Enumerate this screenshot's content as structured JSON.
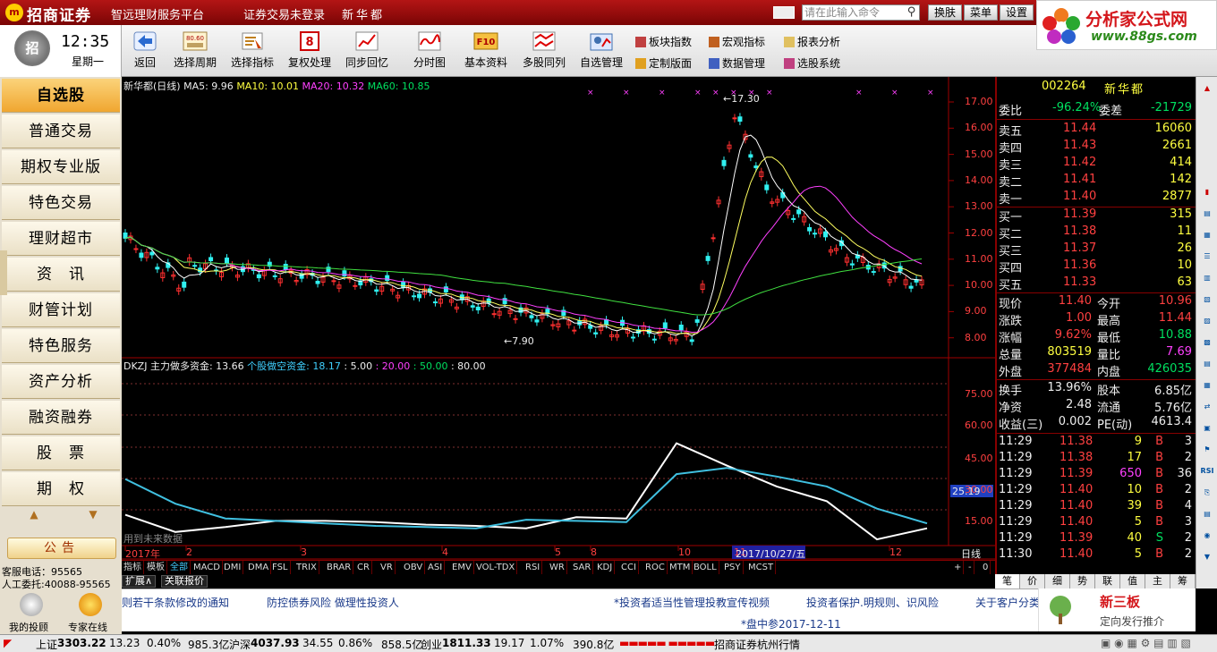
{
  "titlebar": {
    "logo_mark": "m",
    "logo": "招商证券",
    "platform": "智远理财服务平台",
    "login_status": "证券交易未登录",
    "stock_name": "新华都",
    "command_placeholder": "请在此输入命令",
    "buttons": [
      "换肤",
      "菜单",
      "设置"
    ]
  },
  "brand": {
    "name": "分析家公式网",
    "url": "www.88gs.com"
  },
  "clock": {
    "time": "12:35",
    "weekday": "星期一",
    "icon_text": "招"
  },
  "toolbar": {
    "buttons": [
      {
        "label": "返回",
        "icon": "back-arrow-icon"
      },
      {
        "label": "选择周期",
        "icon": "period-icon",
        "icon_text": "80.60"
      },
      {
        "label": "选择指标",
        "icon": "indicator-icon"
      },
      {
        "label": "复权处理",
        "icon": "restore-rights-icon",
        "icon_text": "8"
      },
      {
        "label": "同步回忆",
        "icon": "sync-recall-icon"
      },
      {
        "label": "分时图",
        "icon": "intraday-chart-icon"
      },
      {
        "label": "基本资料",
        "icon": "f10-icon",
        "icon_text": "F10"
      },
      {
        "label": "多股同列",
        "icon": "multi-stock-icon"
      },
      {
        "label": "自选管理",
        "icon": "watchlist-manage-icon"
      }
    ],
    "links": [
      {
        "label": "板块指数",
        "icon": "sector-index-icon"
      },
      {
        "label": "宏观指标",
        "icon": "macro-indicator-icon"
      },
      {
        "label": "报表分析",
        "icon": "report-analysis-icon"
      },
      {
        "label": "定制版面",
        "icon": "custom-layout-icon"
      },
      {
        "label": "数据管理",
        "icon": "data-manage-icon"
      },
      {
        "label": "选股系统",
        "icon": "stock-screener-icon"
      }
    ]
  },
  "sidebar": {
    "items": [
      "自选股",
      "普通交易",
      "期权专业版",
      "特色交易",
      "理财超市",
      "资　讯",
      "财管计划",
      "特色服务",
      "资产分析",
      "融资融券",
      "股　票",
      "期　权"
    ],
    "active_index": 0,
    "scroll_up": "▲",
    "scroll_down": "▼",
    "notice": "公告",
    "hotline": "客服电话：95565",
    "entrust": "人工委托:40088-95565",
    "my_advisor": "我的投顾",
    "expert_online": "专家在线"
  },
  "chart": {
    "header": {
      "name": "新华都(日线)",
      "ma5": "MA5: 9.96",
      "ma10": "MA10: 10.01",
      "ma20": "MA20: 10.32",
      "ma60": "MA60: 10.85"
    },
    "price_max_label": "17.30",
    "price_min_label": "7.90",
    "price_axis": [
      "17.00",
      "16.00",
      "15.00",
      "14.00",
      "13.00",
      "12.00",
      "11.00",
      "10.00",
      "9.00",
      "8.00"
    ],
    "indicator": {
      "name": "DKZJ",
      "main_label": "主力做多资金: 13.66",
      "retail_label": "个股做空资金: 18.17",
      "level1": ": 5.00",
      "level2": ": 20.00",
      "level3": ": 50.00",
      "level4": ": 80.00",
      "axis": [
        "75.00",
        "60.00",
        "45.00",
        "30.00",
        "15.00"
      ],
      "current": "25.19",
      "note": "用到未来数据"
    },
    "date_axis": [
      "2017年",
      "2",
      "3",
      "4",
      "5",
      "8",
      "10",
      "11",
      "12"
    ],
    "cursor_date": "2017/10/27/五",
    "period": "日线",
    "colors": {
      "up": "#ff3030",
      "down": "#30f0f0",
      "ma5": "#ffffff",
      "ma10": "#ffff60",
      "ma20": "#ff40ff",
      "ma60": "#40e040",
      "retail": "#40c0e0"
    },
    "chart_data": {
      "type": "line",
      "series": [
        {
          "name": "主力做多资金",
          "values": [
            25,
            11,
            15,
            20,
            20,
            19,
            17,
            16,
            14,
            23,
            22,
            83,
            65,
            48,
            36,
            5,
            14
          ]
        },
        {
          "name": "个股做空资金",
          "values": [
            54,
            34,
            22,
            20,
            18,
            16,
            15,
            14,
            21,
            20,
            19,
            58,
            63,
            56,
            48,
            30,
            18
          ]
        }
      ]
    }
  },
  "indicator_tabs": [
    "指标",
    "模板",
    "全部",
    "MACD",
    "DMI",
    "DMA",
    "FSL",
    "TRIX",
    "BRAR",
    "CR",
    "VR",
    "OBV",
    "ASI",
    "EMV",
    "VOL-TDX",
    "RSI",
    "WR",
    "SAR",
    "KDJ",
    "CCI",
    "ROC",
    "MTM",
    "BOLL",
    "PSY",
    "MCST"
  ],
  "indicator_tab_controls": [
    "+",
    "-",
    "0"
  ],
  "ext_tabs": [
    "扩展∧",
    "关联报价"
  ],
  "quote": {
    "code": "002264",
    "name": "新华都",
    "webi_label": "委比",
    "webi": "-96.24%",
    "weicha_label": "委差",
    "weicha": "-21729",
    "asks": [
      {
        "label": "卖五",
        "price": "11.44",
        "vol": "16060"
      },
      {
        "label": "卖四",
        "price": "11.43",
        "vol": "2661"
      },
      {
        "label": "卖三",
        "price": "11.42",
        "vol": "414"
      },
      {
        "label": "卖二",
        "price": "11.41",
        "vol": "142"
      },
      {
        "label": "卖一",
        "price": "11.40",
        "vol": "2877"
      }
    ],
    "bids": [
      {
        "label": "买一",
        "price": "11.39",
        "vol": "315"
      },
      {
        "label": "买二",
        "price": "11.38",
        "vol": "11"
      },
      {
        "label": "买三",
        "price": "11.37",
        "vol": "26"
      },
      {
        "label": "买四",
        "price": "11.36",
        "vol": "10"
      },
      {
        "label": "买五",
        "price": "11.33",
        "vol": "63"
      }
    ],
    "stats": [
      {
        "l1": "现价",
        "v1": "11.40",
        "l2": "今开",
        "v2": "10.96"
      },
      {
        "l1": "涨跌",
        "v1": "1.00",
        "l2": "最高",
        "v2": "11.44"
      },
      {
        "l1": "涨幅",
        "v1": "9.62%",
        "l2": "最低",
        "v2": "10.88"
      },
      {
        "l1": "总量",
        "v1": "803519",
        "l2": "量比",
        "v2": "7.69"
      },
      {
        "l1": "外盘",
        "v1": "377484",
        "l2": "内盘",
        "v2": "426035"
      }
    ],
    "fund": [
      {
        "l1": "换手",
        "v1": "13.96%",
        "l2": "股本",
        "v2": "6.85亿"
      },
      {
        "l1": "净资",
        "v1": "2.48",
        "l2": "流通",
        "v2": "5.76亿"
      },
      {
        "l1": "收益(三)",
        "v1": "0.002",
        "l2": "PE(动)",
        "v2": "4613.4"
      }
    ],
    "ticks": [
      {
        "time": "11:29",
        "price": "11.38",
        "vol": "9",
        "bs": "B",
        "n": "3"
      },
      {
        "time": "11:29",
        "price": "11.38",
        "vol": "17",
        "bs": "B",
        "n": "2"
      },
      {
        "time": "11:29",
        "price": "11.39",
        "vol": "650",
        "bs": "B",
        "n": "36"
      },
      {
        "time": "11:29",
        "price": "11.40",
        "vol": "10",
        "bs": "B",
        "n": "2"
      },
      {
        "time": "11:29",
        "price": "11.40",
        "vol": "39",
        "bs": "B",
        "n": "4"
      },
      {
        "time": "11:29",
        "price": "11.40",
        "vol": "5",
        "bs": "B",
        "n": "3"
      },
      {
        "time": "11:29",
        "price": "11.39",
        "vol": "40",
        "bs": "S",
        "n": "2"
      },
      {
        "time": "11:30",
        "price": "11.40",
        "vol": "5",
        "bs": "B",
        "n": "2"
      }
    ]
  },
  "quote_tabs": [
    "笔",
    "价",
    "细",
    "势",
    "联",
    "值",
    "主",
    "筹"
  ],
  "right_strip": [
    "RSI"
  ],
  "news": {
    "items": [
      "则若干条款修改的通知",
      "防控债券风险  做理性投资人",
      "*投资者适当性管理投教宣传视频",
      "投资者保护.明规则、识风险",
      "关于客户分类",
      "*盘中参2017-12-11"
    ],
    "xsb_title": "新三板",
    "xsb_sub": "定向发行推介"
  },
  "status": {
    "sh_label": "上证",
    "sh": "3303.22",
    "sh_chg": "13.23",
    "sh_pct": "0.40%",
    "sh_amt": "985.3亿",
    "sz_label": "沪深",
    "sz": "4037.93",
    "sz_chg": "34.55",
    "sz_pct": "0.86%",
    "sz_amt": "858.5亿",
    "cy_label": "创业",
    "cy": "1811.33",
    "cy_chg": "19.17",
    "cy_pct": "1.07%",
    "cy_amt": "390.8亿",
    "source": "招商证券杭州行情"
  }
}
